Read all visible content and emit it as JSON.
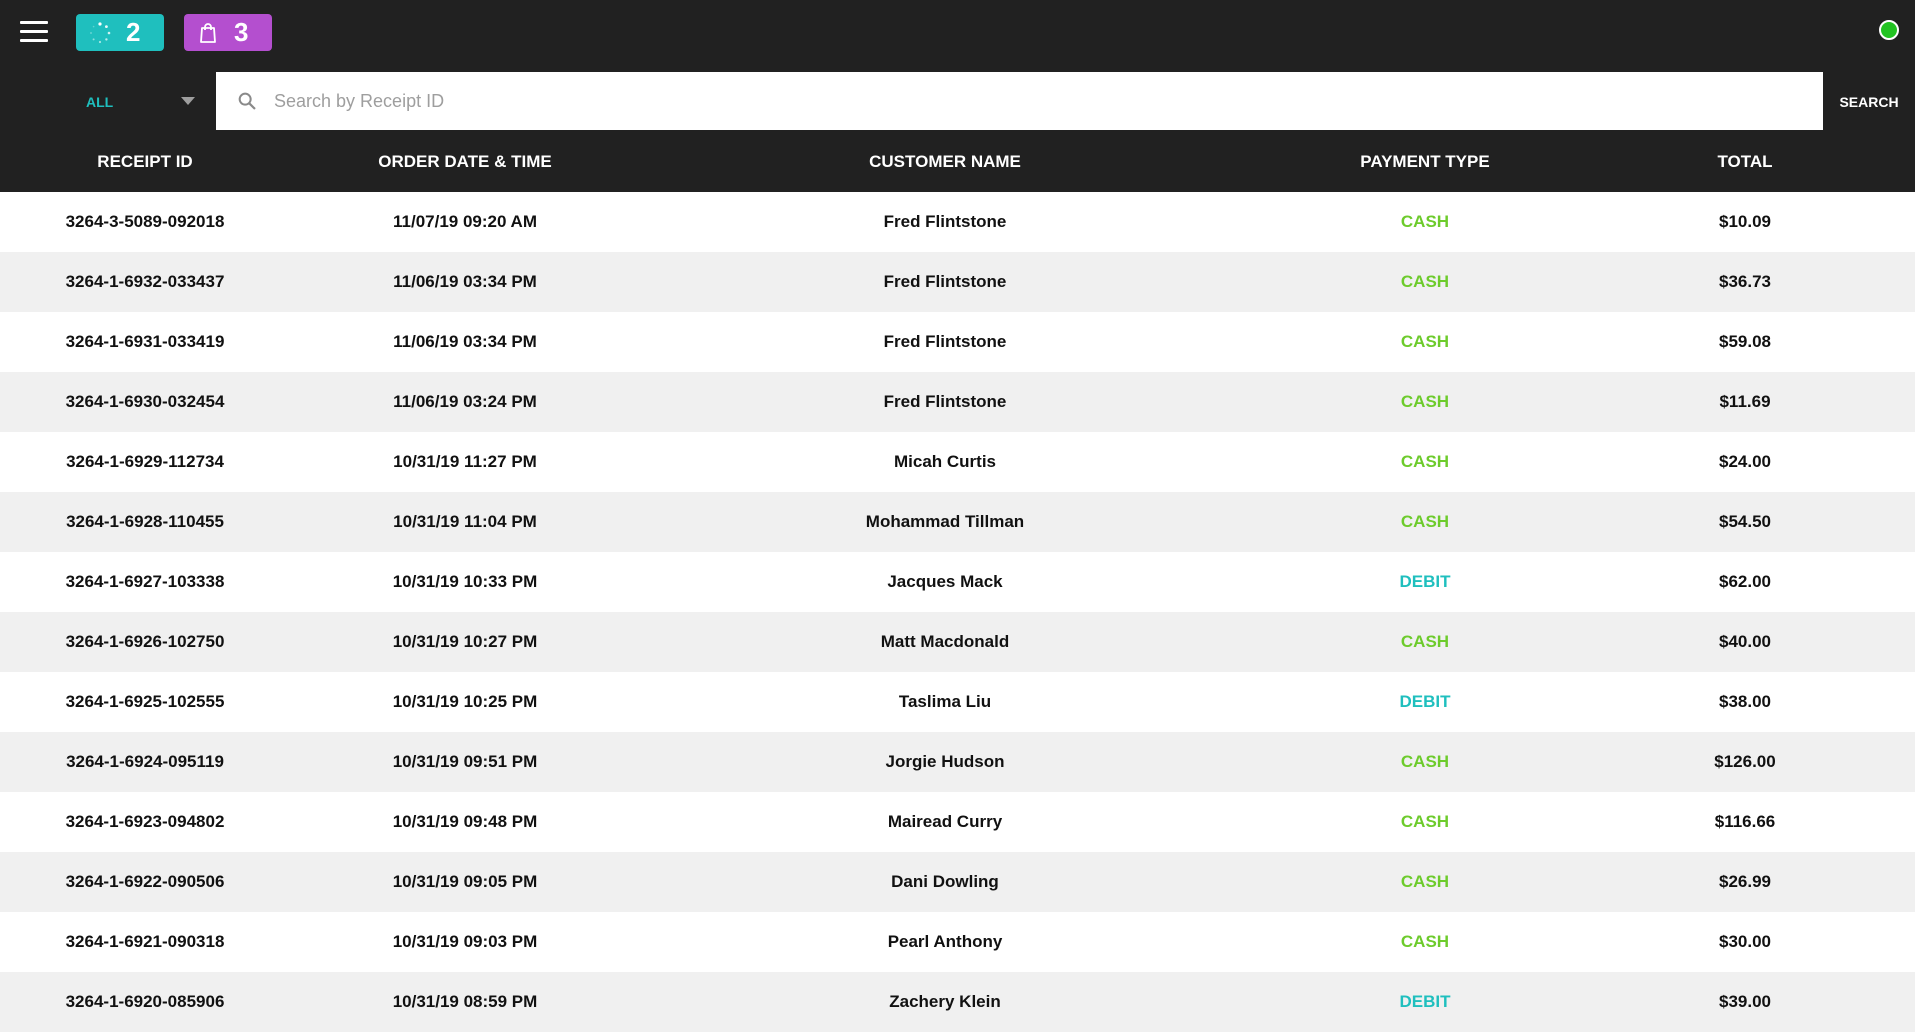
{
  "topbar": {
    "badges": [
      {
        "icon": "loading-spinner-icon",
        "count": "2",
        "color": "#1fbfbe"
      },
      {
        "icon": "shopping-bag-icon",
        "count": "3",
        "color": "#b44fcf"
      }
    ],
    "status_color": "#22c322"
  },
  "search": {
    "filter_value": "ALL",
    "placeholder": "Search by Receipt ID",
    "value": "",
    "button_label": "SEARCH"
  },
  "table": {
    "headers": [
      "RECEIPT ID",
      "ORDER DATE & TIME",
      "CUSTOMER NAME",
      "PAYMENT TYPE",
      "TOTAL"
    ],
    "rows": [
      {
        "receipt_id": "3264-3-5089-092018",
        "datetime": "11/07/19 09:20 AM",
        "customer": "Fred Flintstone",
        "payment": "CASH",
        "total": "$10.09"
      },
      {
        "receipt_id": "3264-1-6932-033437",
        "datetime": "11/06/19 03:34 PM",
        "customer": "Fred Flintstone",
        "payment": "CASH",
        "total": "$36.73"
      },
      {
        "receipt_id": "3264-1-6931-033419",
        "datetime": "11/06/19 03:34 PM",
        "customer": "Fred Flintstone",
        "payment": "CASH",
        "total": "$59.08"
      },
      {
        "receipt_id": "3264-1-6930-032454",
        "datetime": "11/06/19 03:24 PM",
        "customer": "Fred Flintstone",
        "payment": "CASH",
        "total": "$11.69"
      },
      {
        "receipt_id": "3264-1-6929-112734",
        "datetime": "10/31/19 11:27 PM",
        "customer": "Micah Curtis",
        "payment": "CASH",
        "total": "$24.00"
      },
      {
        "receipt_id": "3264-1-6928-110455",
        "datetime": "10/31/19 11:04 PM",
        "customer": "Mohammad Tillman",
        "payment": "CASH",
        "total": "$54.50"
      },
      {
        "receipt_id": "3264-1-6927-103338",
        "datetime": "10/31/19 10:33 PM",
        "customer": "Jacques Mack",
        "payment": "DEBIT",
        "total": "$62.00"
      },
      {
        "receipt_id": "3264-1-6926-102750",
        "datetime": "10/31/19 10:27 PM",
        "customer": "Matt Macdonald",
        "payment": "CASH",
        "total": "$40.00"
      },
      {
        "receipt_id": "3264-1-6925-102555",
        "datetime": "10/31/19 10:25 PM",
        "customer": "Taslima Liu",
        "payment": "DEBIT",
        "total": "$38.00"
      },
      {
        "receipt_id": "3264-1-6924-095119",
        "datetime": "10/31/19 09:51 PM",
        "customer": "Jorgie Hudson",
        "payment": "CASH",
        "total": "$126.00"
      },
      {
        "receipt_id": "3264-1-6923-094802",
        "datetime": "10/31/19 09:48 PM",
        "customer": "Mairead Curry",
        "payment": "CASH",
        "total": "$116.66"
      },
      {
        "receipt_id": "3264-1-6922-090506",
        "datetime": "10/31/19 09:05 PM",
        "customer": "Dani Dowling",
        "payment": "CASH",
        "total": "$26.99"
      },
      {
        "receipt_id": "3264-1-6921-090318",
        "datetime": "10/31/19 09:03 PM",
        "customer": "Pearl Anthony",
        "payment": "CASH",
        "total": "$30.00"
      },
      {
        "receipt_id": "3264-1-6920-085906",
        "datetime": "10/31/19 08:59 PM",
        "customer": "Zachery Klein",
        "payment": "DEBIT",
        "total": "$39.00"
      }
    ]
  }
}
